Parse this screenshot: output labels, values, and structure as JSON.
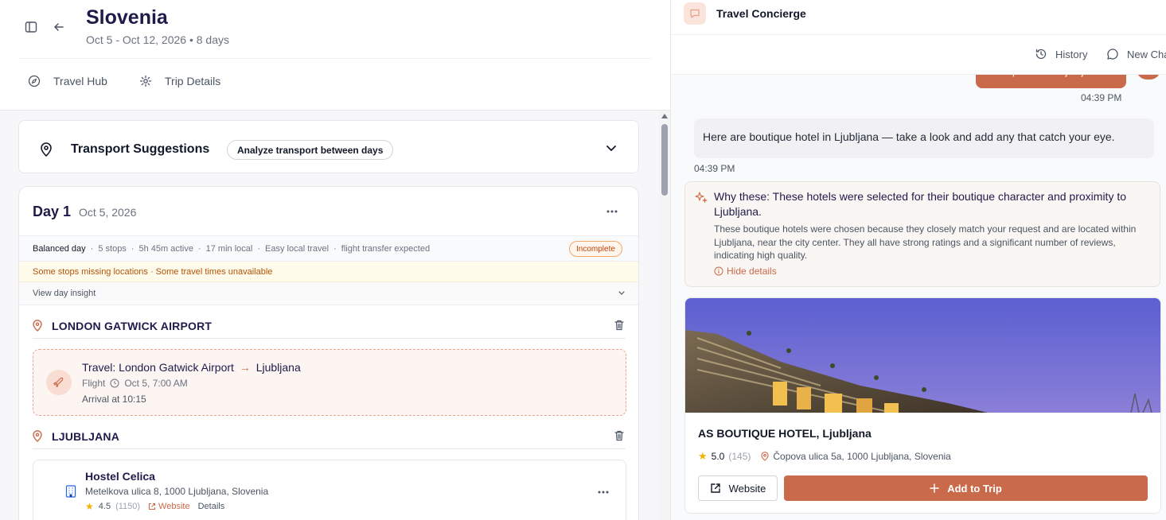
{
  "header": {
    "title": "Slovenia",
    "dates": "Oct 5 - Oct 12, 2026 • 8 days"
  },
  "nav": {
    "travel_hub": "Travel Hub",
    "trip_details": "Trip Details"
  },
  "transport": {
    "title": "Transport Suggestions",
    "analyze_label": "Analyze transport between days"
  },
  "day": {
    "title": "Day 1",
    "date": "Oct 5, 2026",
    "stats": {
      "pace": "Balanced day",
      "stops": "5 stops",
      "active": "5h 45m active",
      "local": "17 min local",
      "ease": "Easy local travel",
      "transfer": "flight transfer expected",
      "sep": "·"
    },
    "badge": "Incomplete",
    "warning": "Some stops missing locations · Some travel times unavailable",
    "insight": "View day insight",
    "stops": [
      {
        "name": "LONDON GATWICK AIRPORT"
      },
      {
        "name": "LJUBLJANA"
      }
    ],
    "travel": {
      "prefix": "Travel: London Gatwick Airport",
      "arrow": "→",
      "dest": "Ljubljana",
      "mode": "Flight",
      "time": "Oct 5, 7:00 AM",
      "arrival": "Arrival at 10:15"
    },
    "hostel": {
      "name": "Hostel Celica",
      "address": "Metelkova ulica 8, 1000 Ljubljana, Slovenia",
      "rating": "4.5",
      "reviews": "(1150)",
      "website": "Website",
      "details": "Details"
    }
  },
  "chat": {
    "title": "Travel Concierge",
    "history": "History",
    "new_chat": "New Cha",
    "user_message": "Boutique hotels Ljubljana",
    "user_time": "04:39 PM",
    "bot_message": "Here are boutique hotel in Ljubljana — take a look and add any that catch your eye.",
    "bot_time": "04:39 PM",
    "why_title": "Why these: These hotels were selected for their boutique character and proximity to Ljubljana.",
    "why_body": "These boutique hotels were chosen because they closely match your request and are located within Ljubljana, near the city center. They all have strong ratings and a significant number of reviews, indicating high quality.",
    "hide_details": "Hide details",
    "hotel": {
      "name": "AS BOUTIQUE HOTEL, Ljubljana",
      "rating": "5.0",
      "reviews": "(145)",
      "address": "Čopova ulica 5a, 1000 Ljubljana, Slovenia",
      "website": "Website",
      "add": "Add to Trip"
    }
  },
  "colors": {
    "accent": "#c96a4a",
    "navy": "#1e1b4b",
    "warning": "#b45309",
    "star": "#f5b301"
  }
}
